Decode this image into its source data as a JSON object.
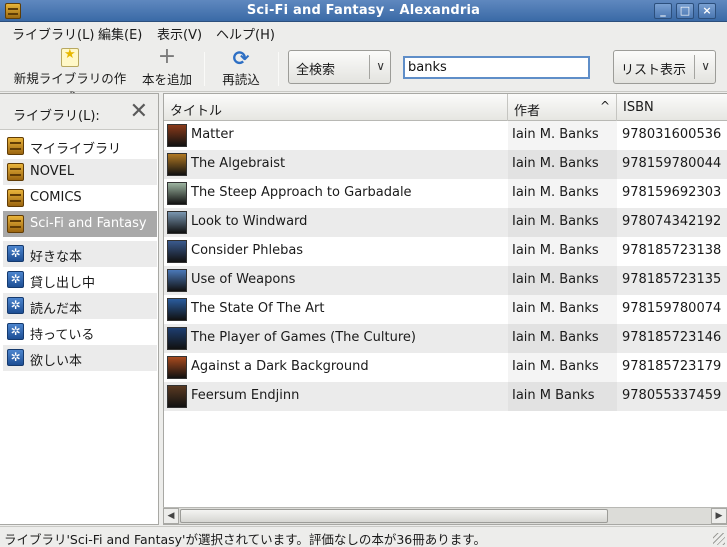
{
  "window": {
    "title": "Sci-Fi and Fantasy - Alexandria",
    "buttons": [
      "_",
      "□",
      "×"
    ]
  },
  "menubar": [
    "ライブラリ(L)",
    "編集(E)",
    "表示(V)",
    "ヘルプ(H)"
  ],
  "toolbar": {
    "new_library": "新規ライブラリの作成",
    "add_book": "本を追加",
    "reload": "再読込",
    "search_mode": "全検索",
    "search_value": "banks",
    "view_mode": "リスト表示",
    "add_icon": "+",
    "reload_icon": "⟳",
    "dropdown_icon": "∨"
  },
  "sidebar": {
    "header": "ライブラリ(L):",
    "close_icon": "✕",
    "libraries": [
      {
        "label": "マイライブラリ",
        "selected": false
      },
      {
        "label": "NOVEL",
        "selected": false
      },
      {
        "label": "COMICS",
        "selected": false
      },
      {
        "label": "Sci-Fi and Fantasy",
        "selected": true
      }
    ],
    "smart_libraries": [
      {
        "label": "好きな本"
      },
      {
        "label": "貸し出し中"
      },
      {
        "label": "読んだ本"
      },
      {
        "label": "持っている"
      },
      {
        "label": "欲しい本"
      }
    ],
    "smart_icon": "✲"
  },
  "table": {
    "columns": {
      "title": "タイトル",
      "author": "作者",
      "isbn": "ISBN",
      "sort_icon": "^"
    },
    "rows": [
      {
        "title": "Matter",
        "author": "Iain M. Banks",
        "isbn": "978031600536",
        "cover": "#8a3a1a"
      },
      {
        "title": "The Algebraist",
        "author": "Iain M. Banks",
        "isbn": "978159780044",
        "cover": "#b07822"
      },
      {
        "title": "The Steep Approach to Garbadale",
        "author": "Iain M. Banks",
        "isbn": "978159692303",
        "cover": "#9cb4a0"
      },
      {
        "title": "Look to Windward",
        "author": "Iain M. Banks",
        "isbn": "978074342192",
        "cover": "#7a96b0"
      },
      {
        "title": "Consider Phlebas",
        "author": "Iain M. Banks",
        "isbn": "978185723138",
        "cover": "#3a5a8e"
      },
      {
        "title": "Use of Weapons",
        "author": "Iain M. Banks",
        "isbn": "978185723135",
        "cover": "#4a78b8"
      },
      {
        "title": "The State Of The Art",
        "author": "Iain M. Banks",
        "isbn": "978159780074",
        "cover": "#2a5c9e"
      },
      {
        "title": "The Player of Games (The Culture)",
        "author": "Iain M. Banks",
        "isbn": "978185723146",
        "cover": "#1e3e70"
      },
      {
        "title": "Against a Dark Background",
        "author": "Iain M. Banks",
        "isbn": "978185723179",
        "cover": "#a84a1e"
      },
      {
        "title": "Feersum Endjinn",
        "author": "Iain M Banks",
        "isbn": "978055337459",
        "cover": "#5a3a22"
      }
    ]
  },
  "statusbar": {
    "text": "ライブラリ'Sci-Fi and Fantasy'が選択されています。評価なしの本が36冊あります。"
  }
}
